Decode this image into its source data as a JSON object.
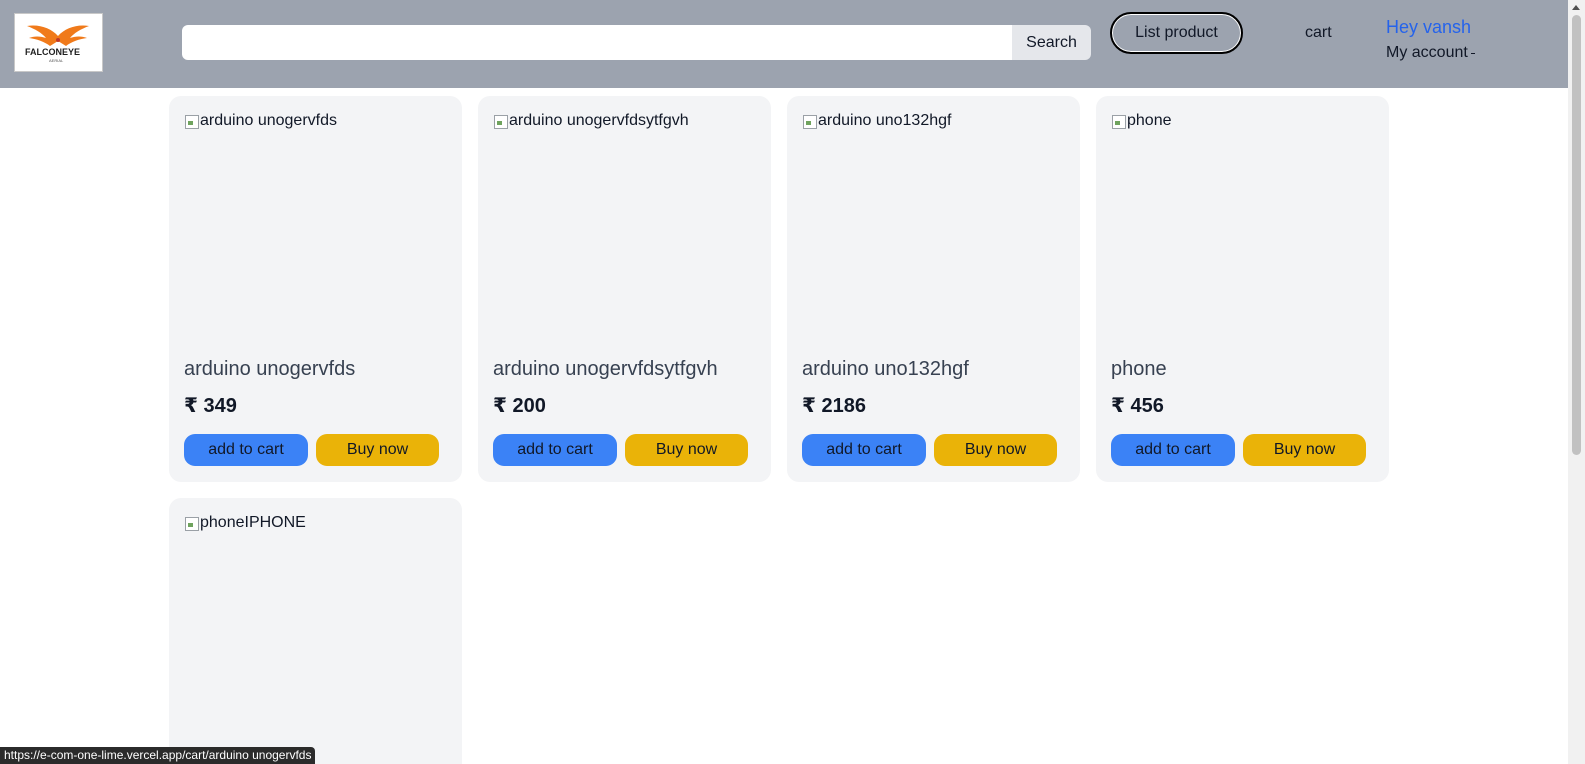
{
  "header": {
    "logo_text": "FALCONEYE",
    "logo_sub": "AERIAL",
    "search": {
      "value": "",
      "placeholder": "",
      "button_label": "Search"
    },
    "list_product_label": "List product",
    "cart_label": "cart",
    "greeting": "Hey vansh",
    "account_label": "My account"
  },
  "products": [
    {
      "image_alt": "arduino unogervfds",
      "title": "arduino unogervfds",
      "price": "₹ 349",
      "add_to_cart_label": "add to cart",
      "buy_now_label": "Buy now"
    },
    {
      "image_alt": "arduino unogervfdsytfgvh",
      "title": "arduino unogervfdsytfgvh",
      "price": "₹ 200",
      "add_to_cart_label": "add to cart",
      "buy_now_label": "Buy now"
    },
    {
      "image_alt": "arduino uno132hgf",
      "title": "arduino uno132hgf",
      "price": "₹ 2186",
      "add_to_cart_label": "add to cart",
      "buy_now_label": "Buy now"
    },
    {
      "image_alt": "phone",
      "title": "phone",
      "price": "₹ 456",
      "add_to_cart_label": "add to cart",
      "buy_now_label": "Buy now"
    },
    {
      "image_alt": "phoneIPHONE"
    }
  ],
  "status_url": "https://e-com-one-lime.vercel.app/cart/arduino unogervfds",
  "colors": {
    "header_bg": "#9ca3af",
    "card_bg": "#f3f4f6",
    "add_to_cart": "#3b82f6",
    "buy_now": "#eab308",
    "greeting": "#2563eb",
    "logo_accent": "#f07a1a"
  }
}
